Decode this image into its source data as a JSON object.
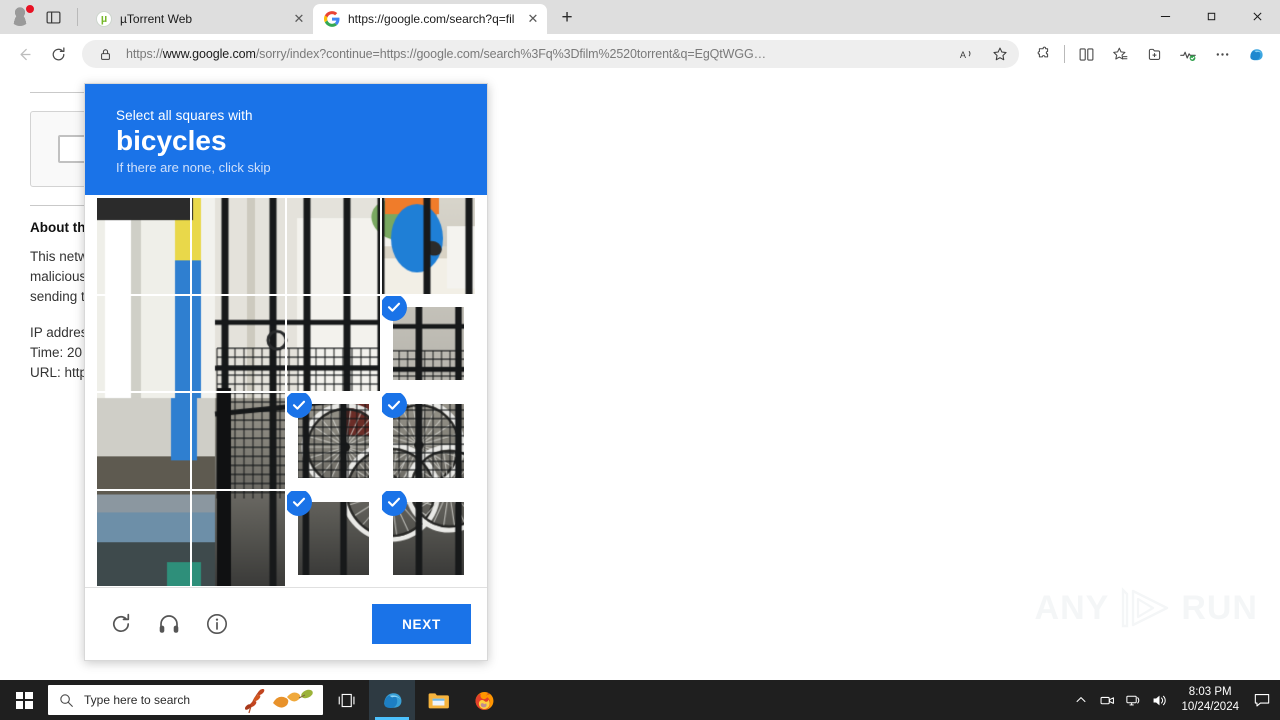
{
  "window": {
    "minimize_label": "—",
    "maximize_label": "❐",
    "close_label": "✕"
  },
  "tabs": [
    {
      "title": "µTorrent Web",
      "favicon": "utorrent-icon",
      "active": false,
      "close_label": "✕"
    },
    {
      "title": "https://google.com/search?q=fil",
      "favicon": "google-icon",
      "active": true,
      "close_label": "✕"
    }
  ],
  "newtab_label": "+",
  "toolbar": {
    "back_label": "←",
    "reload_label": "⟳",
    "url_secure_prefix": "https://",
    "url_domain": "www.google.com",
    "url_rest": "/sorry/index?continue=https://google.com/search%3Fq%3Dfilm%2520torrent&q=EgQtWGG…",
    "read_aloud_label": "A",
    "favorite_label": "☆",
    "extensions_label": "extensions-icon",
    "split_screen_label": "split-screen-icon",
    "collections_label": "collections-icon",
    "add_collection_label": "add-to-collections-icon",
    "browser_essentials_label": "browser-essentials-icon",
    "settings_more_label": "…",
    "copilot_label": "copilot-icon"
  },
  "page": {
    "about_title": "About th",
    "about_body_lines": [
      "This netw",
      "malicious",
      "sending t"
    ],
    "meta_lines": [
      "IP addres",
      "Time: 20",
      "URL: http"
    ]
  },
  "captcha": {
    "prompt_prefix": "Select all squares with",
    "target": "bicycles",
    "hint": "If there are none, click skip",
    "next_label": "NEXT",
    "reload_icon": "reload-icon",
    "audio_icon": "headphones-icon",
    "info_icon": "info-icon",
    "grid": {
      "rows": 4,
      "cols": 4,
      "selected": [
        [
          1,
          3
        ],
        [
          2,
          2
        ],
        [
          2,
          3
        ],
        [
          3,
          2
        ],
        [
          3,
          3
        ]
      ]
    }
  },
  "watermark": {
    "text_left": "ANY",
    "text_right": "RUN"
  },
  "taskbar": {
    "start_label": "start-icon",
    "search_placeholder": "Type here to search",
    "items": [
      {
        "name": "task-view",
        "label": "task-view-icon"
      },
      {
        "name": "edge",
        "label": "edge-icon",
        "active": true
      },
      {
        "name": "file-explorer",
        "label": "file-explorer-icon"
      },
      {
        "name": "firefox",
        "label": "firefox-icon"
      }
    ],
    "tray": {
      "overflow_label": "⌃",
      "camera_label": "camera-icon",
      "network_label": "network-icon",
      "volume_label": "volume-icon"
    },
    "time": "8:03 PM",
    "date": "10/24/2024",
    "notification_label": "notification-icon"
  },
  "colors": {
    "accent_blue": "#1a73e8",
    "taskbar": "#1f1f1f",
    "tabstrip": "#dedede"
  }
}
